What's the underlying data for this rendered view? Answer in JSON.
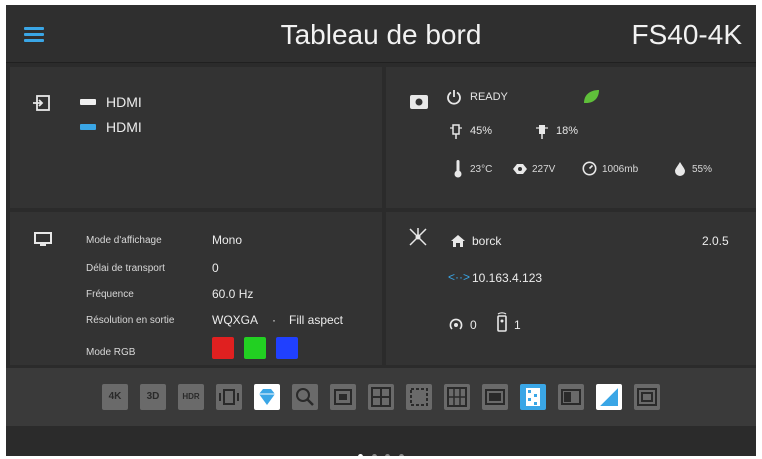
{
  "header": {
    "title": "Tableau de bord",
    "model": "FS40-4K"
  },
  "input": {
    "source_main": "HDMI",
    "source_sub": "HDMI"
  },
  "status": {
    "state": "READY",
    "lamp1": "45%",
    "lamp2": "18%",
    "temperature": "23°C",
    "voltage": "227V",
    "pressure": "1006mb",
    "humidity": "55%",
    "eco_color": "#5fbf3a"
  },
  "display": {
    "rows": [
      {
        "label": "Mode d'affichage",
        "value": "Mono"
      },
      {
        "label": "Délai de transport",
        "value": "0"
      },
      {
        "label": "Fréquence",
        "value": "60.0 Hz"
      },
      {
        "label": "Résolution en sortie",
        "value": "WQXGA",
        "extra": "Fill aspect"
      },
      {
        "label": "Mode RGB",
        "value": ""
      }
    ],
    "separator": "·",
    "rgb_colors": [
      "#e02020",
      "#22d022",
      "#2040ff"
    ]
  },
  "network": {
    "hostname": "borck",
    "version": "2.0.5",
    "ip": "10.163.4.123",
    "wifi_count": "0",
    "remote_count": "1"
  },
  "toolbar": {
    "items": [
      {
        "icon": "4k-icon",
        "text": "4K",
        "active": false
      },
      {
        "icon": "3d-icon",
        "text": "3D",
        "active": false
      },
      {
        "icon": "hdr-icon",
        "text": "HDR",
        "active": false
      },
      {
        "icon": "vibrate-icon",
        "text": "",
        "active": false
      },
      {
        "icon": "diamond-icon",
        "text": "",
        "active": true
      },
      {
        "icon": "zoom-icon",
        "text": "",
        "active": false
      },
      {
        "icon": "picture-icon",
        "text": "",
        "active": false
      },
      {
        "icon": "layout-icon",
        "text": "",
        "active": false
      },
      {
        "icon": "frame-icon",
        "text": "",
        "active": false
      },
      {
        "icon": "grid-icon",
        "text": "",
        "active": false
      },
      {
        "icon": "screen-icon",
        "text": "",
        "active": false
      },
      {
        "icon": "pattern-icon",
        "text": "",
        "active": true
      },
      {
        "icon": "window-icon",
        "text": "",
        "active": false
      },
      {
        "icon": "gradient-icon",
        "text": "",
        "active": true
      },
      {
        "icon": "overlay-icon",
        "text": "",
        "active": false
      }
    ]
  },
  "pager": {
    "count": 4,
    "active": 0
  },
  "colors": {
    "accent": "#3aa6e6",
    "background": "#2b2b2b",
    "panel": "#333333"
  }
}
